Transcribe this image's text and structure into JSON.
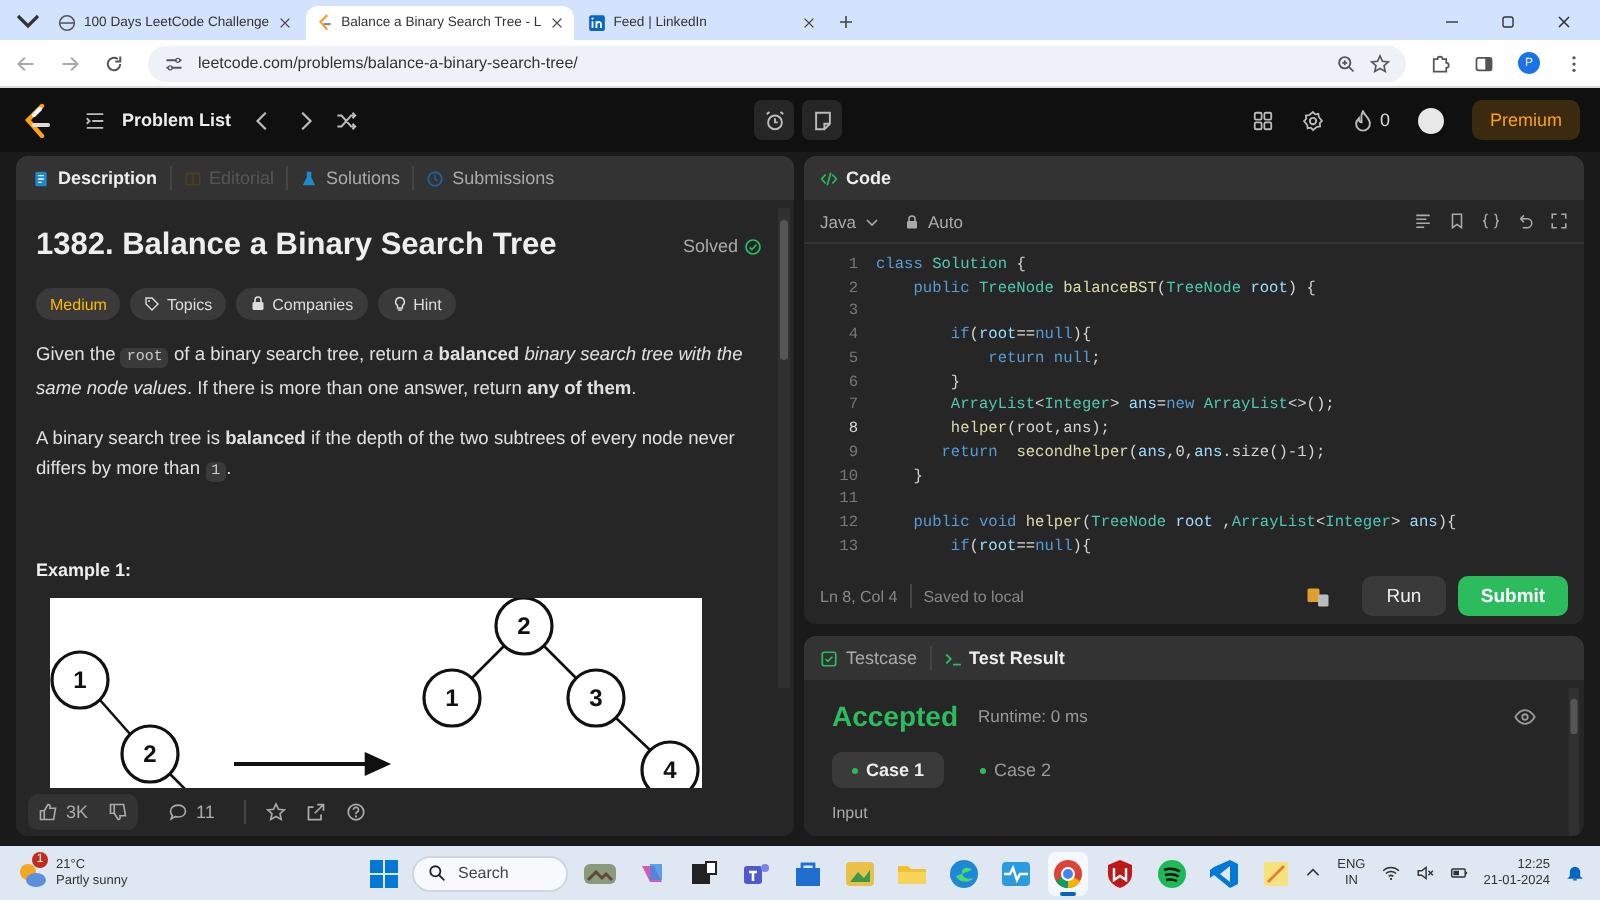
{
  "browser": {
    "tabs": [
      {
        "title": "100 Days LeetCode Challenge",
        "selected": false
      },
      {
        "title": "Balance a Binary Search Tree - L",
        "selected": true
      },
      {
        "title": "Feed | LinkedIn",
        "selected": false
      }
    ],
    "url": "leetcode.com/problems/balance-a-binary-search-tree/",
    "profile": "P"
  },
  "nav": {
    "title": "Problem List",
    "streak": "0",
    "premium": "Premium"
  },
  "description_panel": {
    "tabs": [
      {
        "label": "Description",
        "selected": true,
        "disabled": false
      },
      {
        "label": "Editorial",
        "selected": false,
        "disabled": true
      },
      {
        "label": "Solutions",
        "selected": false,
        "disabled": false
      },
      {
        "label": "Submissions",
        "selected": false,
        "disabled": false
      }
    ],
    "title": "1382. Balance a Binary Search Tree",
    "status": "Solved",
    "tags": [
      {
        "label": "Medium",
        "kind": "difficulty"
      },
      {
        "label": "Topics",
        "kind": "topics"
      },
      {
        "label": "Companies",
        "kind": "companies"
      },
      {
        "label": "Hint",
        "kind": "hint"
      }
    ],
    "paragraphs": [
      [
        {
          "kind": "text",
          "text": "Given the "
        },
        {
          "kind": "code",
          "text": "root"
        },
        {
          "kind": "text",
          "text": " of a binary search tree, return *a* **balanced** *binary search tree with the same node values*. If there is more than one answer, return **any of them**."
        }
      ],
      [
        {
          "kind": "text",
          "text": "A binary search tree is **balanced** if the depth of the two subtrees of every node never differs by more than "
        },
        {
          "kind": "code",
          "text": "1"
        },
        {
          "kind": "text",
          "text": "."
        }
      ]
    ],
    "example_heading": "Example 1:",
    "example": {
      "before_nodes": [
        "1",
        "2"
      ],
      "after_nodes": [
        "2",
        "1",
        "3",
        "4"
      ]
    },
    "footer": {
      "likes": "3K",
      "comments": "11"
    }
  },
  "code_panel": {
    "title": "Code",
    "language": "Java",
    "mode": "Auto",
    "lines": [
      {
        "number": "1",
        "active": false,
        "tokens": [
          {
            "kind": "kw",
            "text": "class "
          },
          {
            "kind": "type",
            "text": "Solution"
          },
          {
            "kind": "plain",
            "text": " {"
          }
        ]
      },
      {
        "number": "2",
        "active": false,
        "tokens": [
          {
            "kind": "kw",
            "text": "    public "
          },
          {
            "kind": "type",
            "text": "TreeNode "
          },
          {
            "kind": "fn",
            "text": "balanceBST"
          },
          {
            "kind": "plain",
            "text": "("
          },
          {
            "kind": "type",
            "text": "TreeNode "
          },
          {
            "kind": "var",
            "text": "root"
          },
          {
            "kind": "plain",
            "text": ") {"
          }
        ]
      },
      {
        "number": "3",
        "active": false
      },
      {
        "number": "4",
        "active": false,
        "tokens": [
          {
            "kind": "kw",
            "text": "        if"
          },
          {
            "kind": "plain",
            "text": "("
          },
          {
            "kind": "var",
            "text": "root"
          },
          {
            "kind": "plain",
            "text": "=="
          },
          {
            "kind": "kw",
            "text": "null"
          },
          {
            "kind": "plain",
            "text": "){"
          }
        ]
      },
      {
        "number": "5",
        "active": false,
        "tokens": [
          {
            "kind": "kw",
            "text": "            return null"
          },
          {
            "kind": "plain",
            "text": ";"
          }
        ]
      },
      {
        "number": "6",
        "active": false,
        "tokens": [
          {
            "kind": "plain",
            "text": "        }"
          }
        ]
      },
      {
        "number": "7",
        "active": false,
        "tokens": [
          {
            "kind": "type",
            "text": "        ArrayList"
          },
          {
            "kind": "plain",
            "text": "<"
          },
          {
            "kind": "type",
            "text": "Integer"
          },
          {
            "kind": "plain",
            "text": "> "
          },
          {
            "kind": "var",
            "text": "ans"
          },
          {
            "kind": "plain",
            "text": "="
          },
          {
            "kind": "kw",
            "text": "new "
          },
          {
            "kind": "type",
            "text": "ArrayList"
          },
          {
            "kind": "plain",
            "text": "<>();"
          }
        ]
      },
      {
        "number": "8",
        "active": true,
        "tokens": [
          {
            "kind": "fn",
            "text": "        helper"
          },
          {
            "kind": "plain",
            "text": "(root,ans);"
          }
        ]
      },
      {
        "number": "9",
        "active": false,
        "tokens": [
          {
            "kind": "kw",
            "text": "       return  "
          },
          {
            "kind": "fn",
            "text": "secondhelper"
          },
          {
            "kind": "plain",
            "text": "("
          },
          {
            "kind": "var",
            "text": "ans"
          },
          {
            "kind": "plain",
            "text": ",0,"
          },
          {
            "kind": "var",
            "text": "ans"
          },
          {
            "kind": "plain",
            "text": ".size()-1);"
          }
        ]
      },
      {
        "number": "10",
        "active": false,
        "tokens": [
          {
            "kind": "plain",
            "text": "    }"
          }
        ]
      },
      {
        "number": "11",
        "active": false
      },
      {
        "number": "12",
        "active": false,
        "tokens": [
          {
            "kind": "kw",
            "text": "    public void "
          },
          {
            "kind": "fn",
            "text": "helper"
          },
          {
            "kind": "plain",
            "text": "("
          },
          {
            "kind": "type",
            "text": "TreeNode "
          },
          {
            "kind": "var",
            "text": "root "
          },
          {
            "kind": "plain",
            "text": ","
          },
          {
            "kind": "type",
            "text": "ArrayList"
          },
          {
            "kind": "plain",
            "text": "<"
          },
          {
            "kind": "type",
            "text": "Integer"
          },
          {
            "kind": "plain",
            "text": "> "
          },
          {
            "kind": "var",
            "text": "ans"
          },
          {
            "kind": "plain",
            "text": "){"
          }
        ]
      },
      {
        "number": "13",
        "active": false,
        "tokens": [
          {
            "kind": "kw",
            "text": "        if"
          },
          {
            "kind": "plain",
            "text": "("
          },
          {
            "kind": "var",
            "text": "root"
          },
          {
            "kind": "plain",
            "text": "=="
          },
          {
            "kind": "kw",
            "text": "null"
          },
          {
            "kind": "plain",
            "text": "){"
          }
        ]
      }
    ],
    "cursor": "Ln 8, Col 4",
    "saved": "Saved to local",
    "run": "Run",
    "submit": "Submit"
  },
  "result_panel": {
    "tabs": [
      {
        "label": "Testcase",
        "selected": false
      },
      {
        "label": "Test Result",
        "selected": true
      }
    ],
    "verdict": "Accepted",
    "runtime": "Runtime: 0 ms",
    "cases": [
      {
        "label": "Case 1",
        "selected": true
      },
      {
        "label": "Case 2",
        "selected": false
      }
    ],
    "input_label": "Input"
  },
  "taskbar": {
    "weather": {
      "temperature": "21°C",
      "condition": "Partly sunny",
      "badge": "1"
    },
    "search": {
      "placeholder": "Search"
    },
    "apps": [
      {
        "kind": "picture",
        "active": false
      },
      {
        "kind": "copilot",
        "active": false
      },
      {
        "kind": "taskview",
        "active": false
      },
      {
        "kind": "teams",
        "active": false
      },
      {
        "kind": "store",
        "active": false
      },
      {
        "kind": "photos",
        "active": false
      },
      {
        "kind": "folder",
        "active": false
      },
      {
        "kind": "edge",
        "active": false
      },
      {
        "kind": "wave",
        "active": false
      },
      {
        "kind": "chrome",
        "active": true
      },
      {
        "kind": "shield",
        "active": false
      },
      {
        "kind": "spotify",
        "active": false
      },
      {
        "kind": "vscode",
        "active": false
      },
      {
        "kind": "sticky",
        "active": false
      }
    ],
    "language": "ENG",
    "region": "IN",
    "time": "12:25",
    "date": "21-01-2024"
  }
}
